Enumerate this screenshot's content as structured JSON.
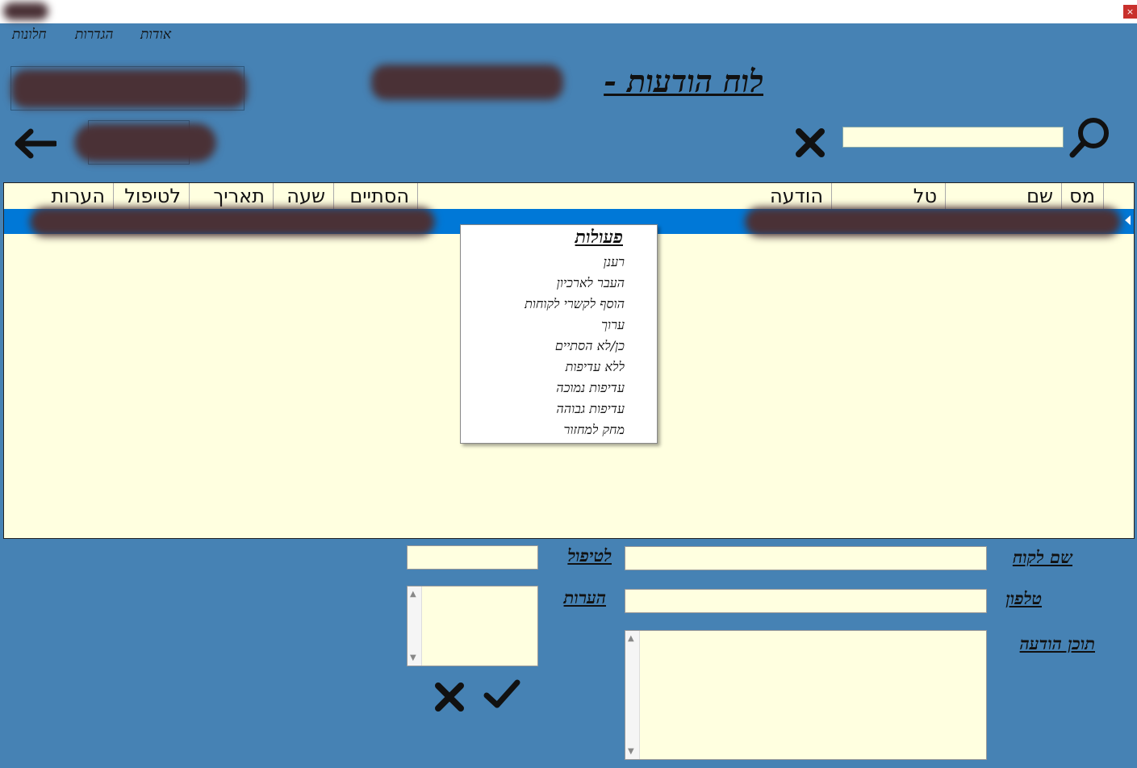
{
  "window": {
    "close_glyph": "×"
  },
  "menu": [
    {
      "label": "חלונות"
    },
    {
      "label": "הגדרות"
    },
    {
      "label": "אודות"
    }
  ],
  "title": "לוח הודעות -",
  "grid": {
    "columns": [
      "מס",
      "שם",
      "טל",
      "הודעה",
      "הסתיים",
      "שעה",
      "תאריך",
      "לטיפול",
      "הערות"
    ]
  },
  "context_menu": {
    "title": "פעולות",
    "items": [
      "רענן",
      "העבר לארכיון",
      "הוסף לקשרי לקוחות",
      "ערוך",
      "כן/לא הסתיים",
      "ללא עדיפות",
      "עדיפות נמוכה",
      "עדיפות גבוהה",
      "מחק למחזור"
    ]
  },
  "form": {
    "customer_name_label": "שם לקוח",
    "phone_label": "טלפון",
    "message_label": "תוכן הודעה",
    "handler_label": "לטיפול",
    "notes_label": "הערות"
  },
  "icons": {
    "back": "arrow-left-icon",
    "clear": "x-icon",
    "search": "magnifier-icon",
    "confirm": "checkmark-icon",
    "cancel": "x-icon"
  },
  "colors": {
    "background": "#4682b4",
    "field": "#ffffe0",
    "selection": "#0078d7"
  }
}
